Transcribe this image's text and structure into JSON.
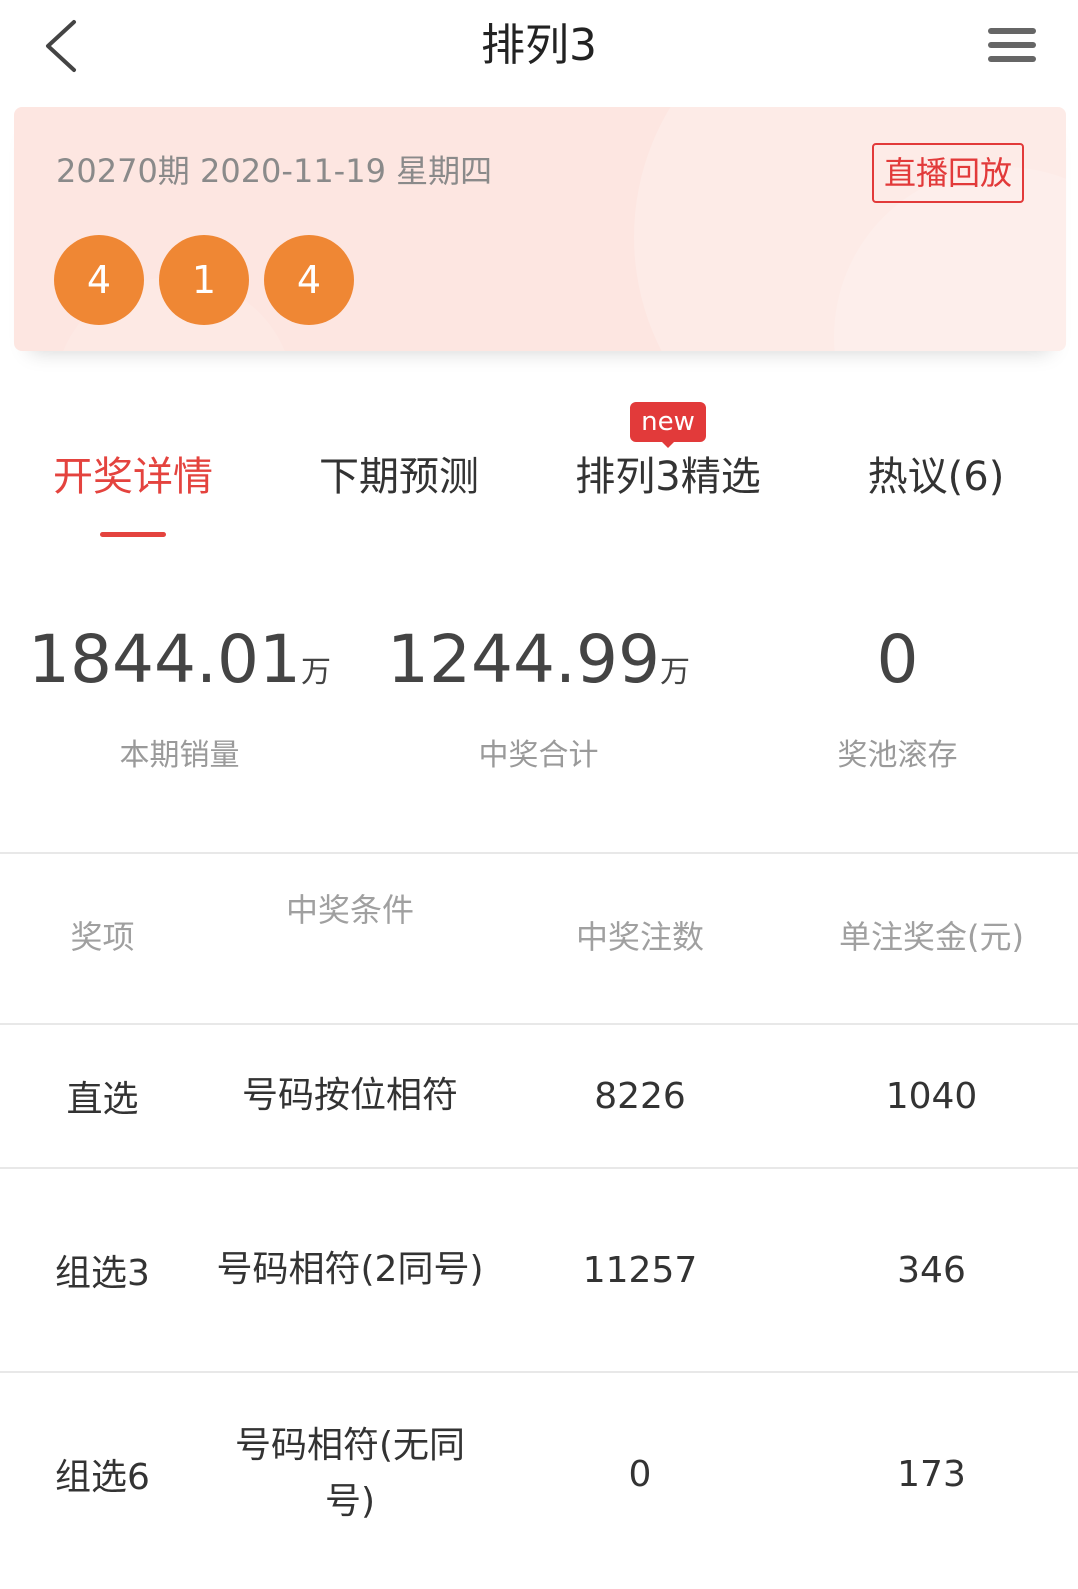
{
  "header": {
    "title": "排列3"
  },
  "draw": {
    "info": "20270期 2020-11-19 星期四",
    "replay_label": "直播回放",
    "numbers": [
      "4",
      "1",
      "4"
    ]
  },
  "tabs": [
    {
      "label": "开奖详情",
      "active": true
    },
    {
      "label": "下期预测",
      "active": false
    },
    {
      "label": "排列3精选",
      "active": false,
      "badge": "new"
    },
    {
      "label": "热议(6)",
      "active": false
    }
  ],
  "stats": [
    {
      "value": "1844.01",
      "unit": "万",
      "label": "本期销量"
    },
    {
      "value": "1244.99",
      "unit": "万",
      "label": "中奖合计"
    },
    {
      "value": "0",
      "unit": "",
      "label": "奖池滚存"
    }
  ],
  "table": {
    "headers": [
      "奖项",
      "中奖条件",
      "中奖注数",
      "单注奖金(元)"
    ],
    "rows": [
      [
        "直选",
        "号码按位相符",
        "8226",
        "1040"
      ],
      [
        "组选3",
        "号码相符(2同号)",
        "11257",
        "346"
      ],
      [
        "组选6",
        "号码相符(无同号)",
        "0",
        "173"
      ]
    ]
  },
  "colors": {
    "accent": "#e4433e",
    "ball": "#ef8734",
    "card_bg": "#fde6e1"
  }
}
